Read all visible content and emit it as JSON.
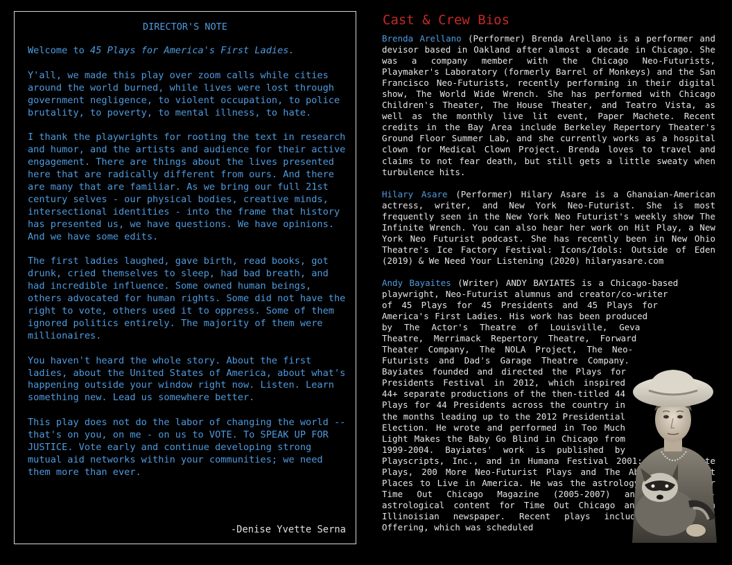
{
  "director_note": {
    "title": "DIRECTOR'S NOTE",
    "intro_prefix": "Welcome to ",
    "intro_title": "45 Plays for America's First Ladies.",
    "paragraphs": [
      "Y'all, we made this play over zoom calls while cities around the world burned, while lives were lost through government negligence, to violent occupation, to police brutality, to poverty, to mental illness, to hate.",
      "I thank the playwrights for rooting the text in research and humor, and the artists and audience for their active engagement. There are things about the lives presented here that are radically different from ours. And there are many that are familiar. As we bring our full 21st century selves - our physical bodies, creative minds, intersectional identities - into the frame that history has presented us, we have questions. We have opinions. And we have some edits.",
      "The first ladies laughed, gave birth, read books, got drunk, cried themselves to sleep, had bad breath, and had incredible influence. Some owned human beings, others advocated for human rights. Some did not have the right to vote, others used it to oppress. Some of them ignored politics entirely. The majority of them were millionaires.",
      "You haven't heard the whole story. About the first ladies, about the United States of America, about what's happening outside your window right now. Listen. Learn something new. Lead us somewhere better.",
      "This play does not do the labor of changing the world -- that's on you, on me - on us to VOTE. To SPEAK UP FOR JUSTICE. Vote early and continue developing strong mutual aid networks within your communities; we need them more than ever."
    ],
    "signature": "-Denise Yvette Serna"
  },
  "bios": {
    "title": "Cast & Crew Bios",
    "entries": [
      {
        "name": "Brenda Arellano",
        "text": " (Performer) Brenda Arellano is a performer and devisor based in Oakland after almost a decade in Chicago. She was a company member with the Chicago Neo-Futurists, Playmaker's Laboratory (formerly Barrel of Monkeys) and the San Francisco Neo-Futurists, recently performing in their digital show, The World Wide Wrench. She has performed with Chicago Children's Theater, The House Theater, and Teatro Vista, as well as the monthly live lit event, Paper Machete. Recent credits in the Bay Area include Berkeley Repertory Theater's Ground Floor Summer Lab, and she currently works as a hospital clown for Medical Clown Project. Brenda loves to travel and claims to not fear death, but still gets a little sweaty when turbulence hits."
      },
      {
        "name": "Hilary Asare",
        "text": " (Performer) Hilary Asare is a Ghanaian-American actress, writer, and New York Neo-Futurist. She is most frequently seen in the New York Neo Futurist's weekly show The Infinite Wrench. You can also hear her work on Hit Play, a New York Neo Futurist podcast. She has recently been in New Ohio Theatre's Ice Factory Festival: Icons/Idols: Outside of Eden (2019) & We Need Your Listening (2020) hilaryasare.com"
      },
      {
        "name": "Andy Bayaites",
        "text": " (Writer) ANDY BAYIATES is a Chicago-based playwright, Neo-Futurist alumnus and creator/co-writer of 45 Plays for 45 Presidents and 45 Plays for America's First Ladies. His work has been produced by The Actor's Theatre of Louisville, Geva Theatre, Merrimack Repertory Theatre, Forward Theater Company, The NOLA Project, The Neo-Futurists and Dad's Garage Theatre Company. Bayiates founded and directed the Plays for Presidents Festival in 2012, which inspired 44+ separate productions of the then-titled 44 Plays for 44 Presidents across the country in the months leading up to the 2012 Presidential Election. He wrote and performed in Too Much Light Makes the Baby Go Blind in Chicago from 1999-2004. Bayiates' work is published by Playscripts, Inc., and in Humana Festival 2001: The Complete Plays, 200 More Neo-Futurist Plays and The Absolutely Worst Places to Live in America. He was the astrology columnist for Time Out Chicago Magazine (2005-2007) and wrote non-astrological content for Time Out Chicago and the Southern Illinoisian newspaper. Recent plays include The Lowell Offering, which was scheduled"
      }
    ]
  }
}
